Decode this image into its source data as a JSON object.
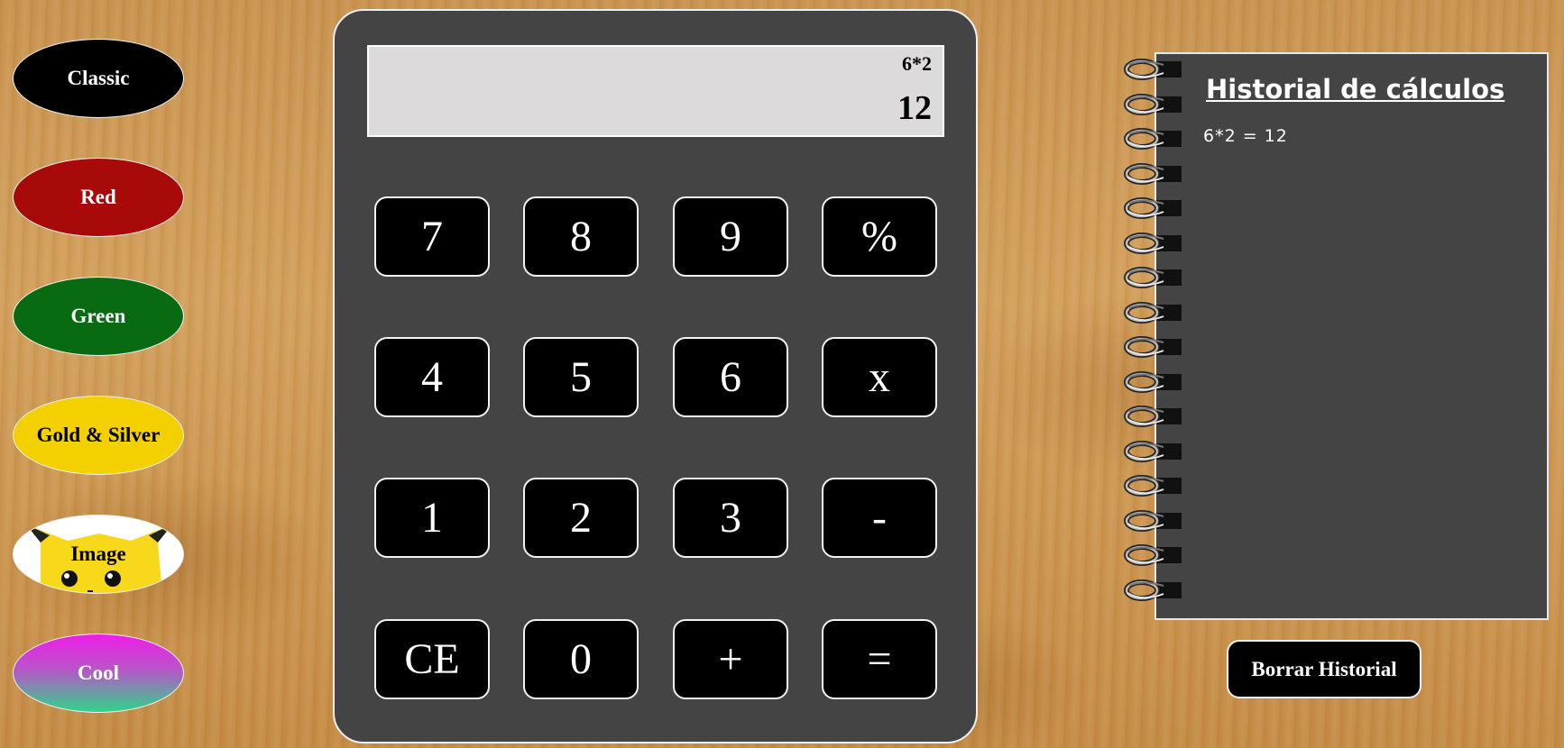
{
  "themes": [
    {
      "label": "Classic"
    },
    {
      "label": "Red"
    },
    {
      "label": "Green"
    },
    {
      "label": "Gold & Silver"
    },
    {
      "label": "Image"
    },
    {
      "label": "Cool"
    }
  ],
  "calculator": {
    "expression": "6*2",
    "result": "12",
    "keys": [
      "7",
      "8",
      "9",
      "%",
      "4",
      "5",
      "6",
      "x",
      "1",
      "2",
      "3",
      "-",
      "CE",
      "0",
      "+",
      "="
    ]
  },
  "history": {
    "title": "Historial de cálculos",
    "entries": [
      "6*2 = 12"
    ],
    "clear_label": "Borrar Historial"
  },
  "colors": {
    "classic": "#000000",
    "red": "#a80a0a",
    "green": "#086b12",
    "gold": "#f5d000",
    "calculator_body": "#444444",
    "display": "#dcdada",
    "notebook": "#444444"
  },
  "icons": {
    "image_theme": "pikachu-face-icon",
    "notebook_binding": "spiral-ring-icon"
  }
}
